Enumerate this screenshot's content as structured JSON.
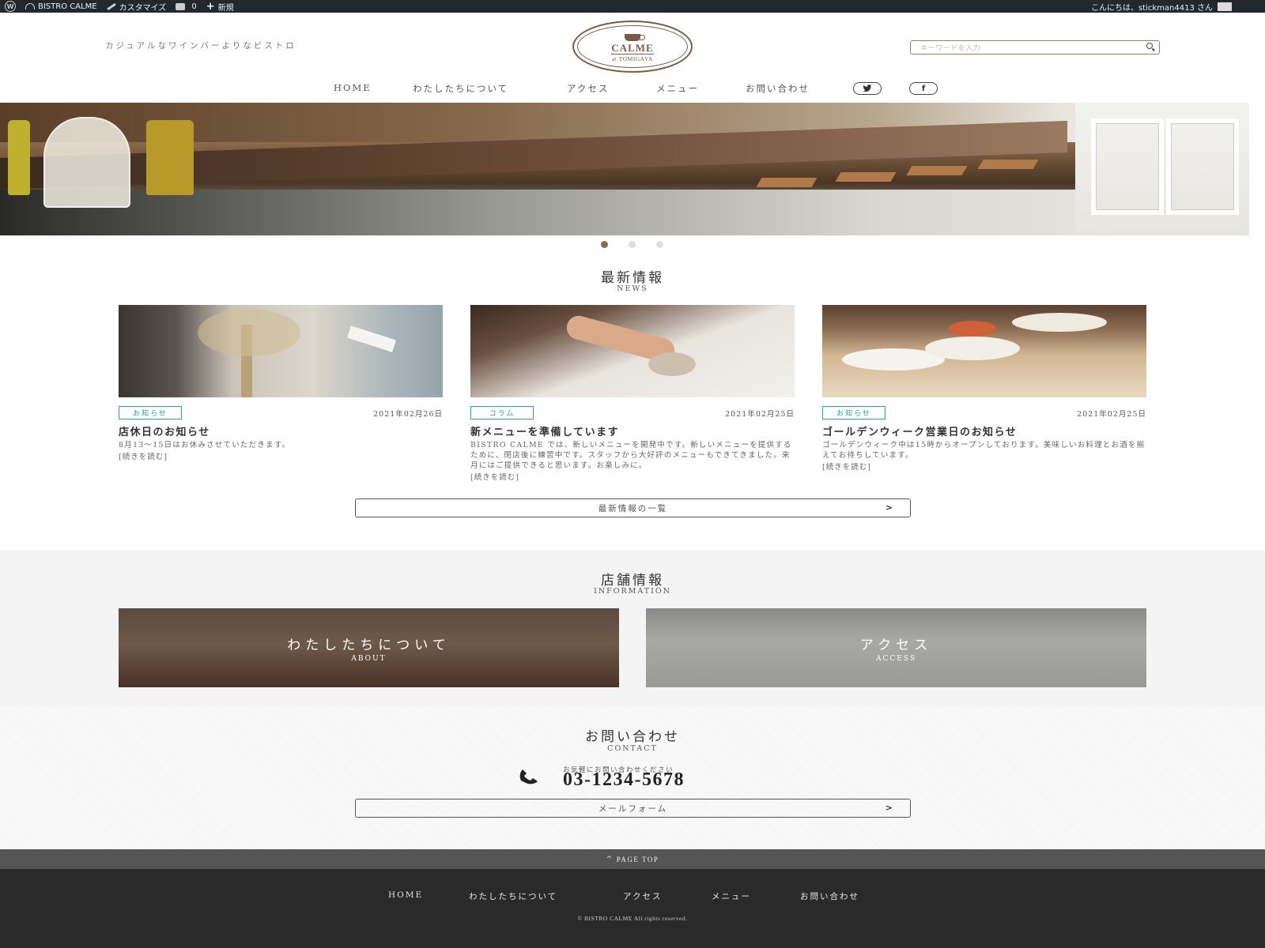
{
  "admin_bar": {
    "site_name": "BISTRO CALME",
    "customize": "カスタマイズ",
    "comments_count": "0",
    "new_label": "新規",
    "greeting": "こんにちは、stickman4413 さん"
  },
  "header": {
    "tagline": "カジュアルなワインバーよりなビストロ",
    "logo_name": "CALME",
    "logo_sub": "at TOMIGAYA",
    "search_placeholder": "キーワードを入力"
  },
  "nav": {
    "items": [
      "HOME",
      "わたしたちについて",
      "アクセス",
      "メニュー",
      "お問い合わせ"
    ],
    "twitter_label": "twitter",
    "facebook_label": "f"
  },
  "slider": {
    "dots": 3,
    "active": 1
  },
  "news": {
    "title": "最新情報",
    "subtitle": "NEWS",
    "posts": [
      {
        "category": "お知らせ",
        "date": "2021年02月26日",
        "title": "店休日のお知らせ",
        "excerpt": "8月13～15日はお休みさせていただきます。",
        "more": "[続きを読む]"
      },
      {
        "category": "コラム",
        "date": "2021年02月25日",
        "title": "新メニューを準備しています",
        "excerpt": "BISTRO CALME では、新しいメニューを開発中です。新しいメニューを提供するために、閉店後に練習中です。スタッフから大好評のメニューもできてきました。来月にはご提供できると思います。お楽しみに。",
        "more": "[続きを読む]"
      },
      {
        "category": "お知らせ",
        "date": "2021年02月25日",
        "title": "ゴールデンウィーク営業日のお知らせ",
        "excerpt": "ゴールデンウィーク中は15時からオープンしております。美味しいお料理とお酒を揃えてお待ちしています。",
        "more": "[続きを読む]"
      }
    ],
    "list_button": "最新情報の一覧",
    "arrow": ">"
  },
  "info": {
    "title": "店舗情報",
    "subtitle": "INFORMATION",
    "tiles": [
      {
        "title": "わたしたちについて",
        "sub": "ABOUT"
      },
      {
        "title": "アクセス",
        "sub": "ACCESS"
      }
    ]
  },
  "contact": {
    "title": "お問い合わせ",
    "subtitle": "CONTACT",
    "note": "お気軽にお問い合わせください",
    "phone": "03-1234-5678",
    "mail_button": "メールフォーム",
    "arrow": ">"
  },
  "footer": {
    "page_top": "PAGE TOP",
    "nav": [
      "HOME",
      "わたしたちについて",
      "アクセス",
      "メニュー",
      "お問い合わせ"
    ],
    "copyright": "© BISTRO CALME All rights reserved."
  },
  "colors": {
    "brand_brown": "#7a5a48",
    "category_teal": "#2aa2a8",
    "admin_bar": "#23282d",
    "footer": "#2a2a2a"
  }
}
